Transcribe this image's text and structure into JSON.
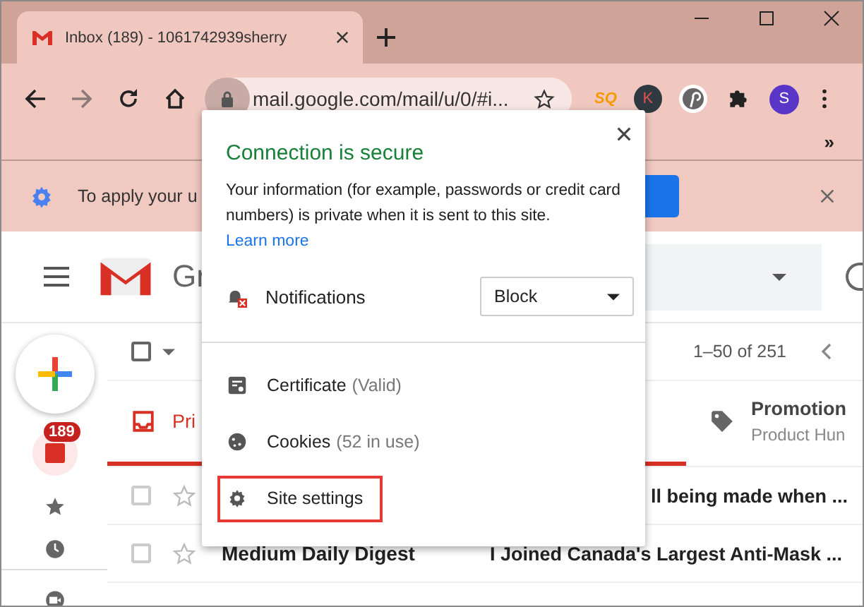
{
  "browser": {
    "tab": {
      "title": "Inbox (189) - 1061742939sherry"
    },
    "address": {
      "url": "mail.google.com/mail/u/0/#i..."
    },
    "extensions": [
      {
        "kind": "sq",
        "label": "SQ"
      },
      {
        "kind": "letter",
        "label": "K"
      },
      {
        "kind": "pin"
      },
      {
        "kind": "puzzle"
      }
    ],
    "profile": {
      "initial": "S"
    },
    "bookmarks_more": "»"
  },
  "infobar": {
    "text": "To apply your u"
  },
  "gmail": {
    "logo_text": "Gr",
    "select_all": {
      "checked": false
    },
    "unread_badge": "189",
    "pagination": "1–50 of 251",
    "tabs": [
      {
        "label": "Pri",
        "selected": true
      },
      {
        "label": "Promotion",
        "subtitle": "Product Hun",
        "selected": false
      }
    ],
    "rows": [
      {
        "sender": "",
        "subject": "ll being made when ...",
        "checked": false
      },
      {
        "sender": "Medium Daily Digest",
        "checked": false,
        "subject": "I Joined Canada's Largest Anti-Mask ..."
      }
    ]
  },
  "popup": {
    "title": "Connection is secure",
    "body": "Your information (for example, passwords or credit card numbers) is private when it is sent to this site.",
    "link": "Learn more",
    "permission": {
      "label": "Notifications",
      "value": "Block"
    },
    "items": [
      {
        "kind": "certificate",
        "label": "Certificate",
        "note": "(Valid)",
        "highlighted": false
      },
      {
        "kind": "cookies",
        "label": "Cookies",
        "note": "(52 in use)",
        "highlighted": false
      },
      {
        "kind": "settings",
        "label": "Site settings",
        "highlighted": true
      }
    ]
  }
}
